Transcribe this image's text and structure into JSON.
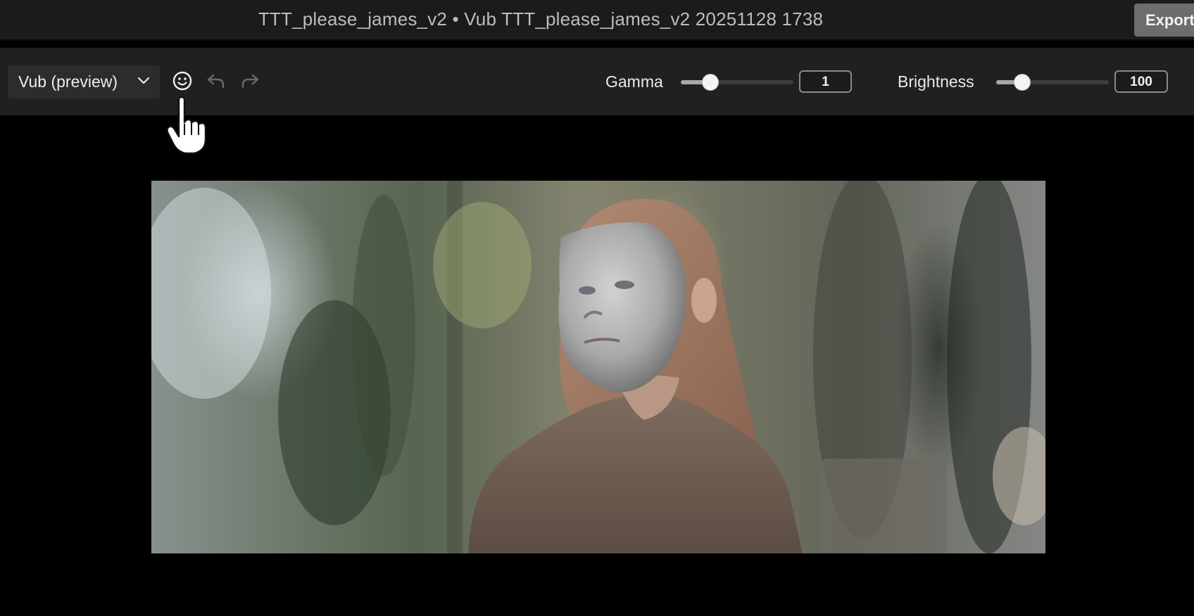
{
  "titlebar": {
    "title": "TTT_please_james_v2 • Vub TTT_please_james_v2 20251128 1738",
    "export_label": "Export"
  },
  "toolbar": {
    "preview_select": "Vub (preview)",
    "icons": [
      "face-icon",
      "undo-icon",
      "redo-icon"
    ],
    "gamma": {
      "label": "Gamma",
      "value": "1",
      "level": 0.26
    },
    "brightness": {
      "label": "Brightness",
      "value": "100",
      "level": 0.23
    }
  },
  "viewer": {
    "content": "video-frame"
  },
  "colors": {
    "titlebar_bg": "#1b1b1b",
    "toolbar_bg": "#202020",
    "export_bg": "#6d6d6d",
    "viewer_bg": "#000000"
  }
}
